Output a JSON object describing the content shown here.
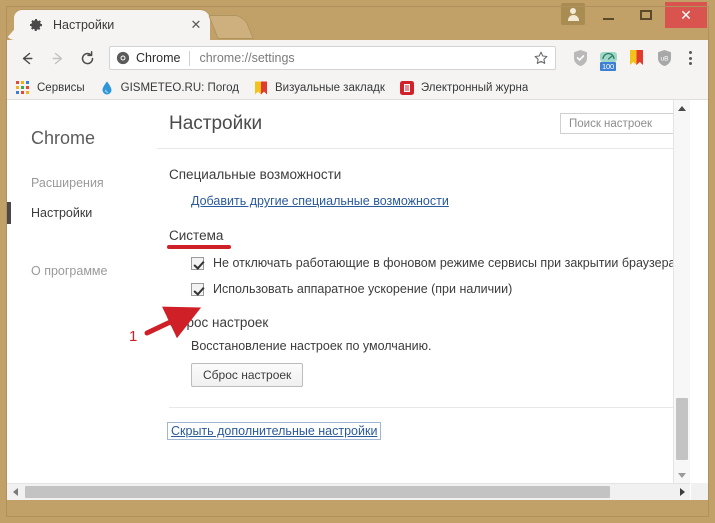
{
  "window": {
    "close_label": "✕",
    "minimize_label": "minimize",
    "maximize_label": "maximize",
    "avatar_label": "person-avatar"
  },
  "tab": {
    "title": "Настройки",
    "close_label": "✕",
    "favicon": "gear-icon",
    "newtab_label": "new-tab"
  },
  "toolbar": {
    "back_label": "←",
    "forward_label": "→",
    "reload_label": "⟳",
    "omnibox": {
      "chip_label": "Chrome",
      "url": "chrome://settings",
      "star": "star-icon"
    },
    "extensions": [
      {
        "name": "adguard-shield-icon",
        "badge": ""
      },
      {
        "name": "traffic-monitor-icon",
        "badge": "100"
      },
      {
        "name": "visual-bookmarks-icon",
        "badge": ""
      },
      {
        "name": "ublock-origin-icon",
        "badge": ""
      }
    ],
    "menu_label": "chrome-menu"
  },
  "bookmarks": [
    {
      "label": "Сервисы",
      "icon": "apps-grid-icon"
    },
    {
      "label": "GISMETEO.RU: Погод",
      "icon": "water-drop-icon"
    },
    {
      "label": "Визуальные закладк",
      "icon": "bookmark-ribbon-icon"
    },
    {
      "label": "Электронный журна",
      "icon": "red-journal-icon"
    }
  ],
  "sidebar": {
    "brand": "Chrome",
    "items": [
      {
        "label": "Расширения",
        "active": false
      },
      {
        "label": "Настройки",
        "active": true
      },
      {
        "label": "О программе",
        "active": false
      }
    ]
  },
  "main": {
    "title": "Настройки",
    "search_placeholder": "Поиск настроек",
    "search_value": "",
    "accessibility": {
      "heading": "Специальные возможности",
      "link": "Добавить другие специальные возможности"
    },
    "system": {
      "heading": "Система",
      "checkbox_background": "Не отключать работающие в фоновом режиме сервисы при закрытии браузера",
      "checkbox_background_checked": true,
      "checkbox_hwaccel": "Использовать аппаратное ускорение (при наличии)",
      "checkbox_hwaccel_checked": true
    },
    "reset": {
      "heading": "Сброс настроек",
      "description": "Восстановление настроек по умолчанию.",
      "button": "Сброс настроек"
    },
    "hide_advanced": "Скрыть дополнительные настройки"
  },
  "annotations": {
    "marker_number": "1",
    "arrow_color": "#cf2027",
    "underline_color": "#cf2027"
  },
  "colors": {
    "frame": "#c2a169",
    "toolbar": "#f6f4f2",
    "link": "#2b5a9b",
    "close_button": "#d9534f",
    "accent_red": "#cf2027"
  }
}
